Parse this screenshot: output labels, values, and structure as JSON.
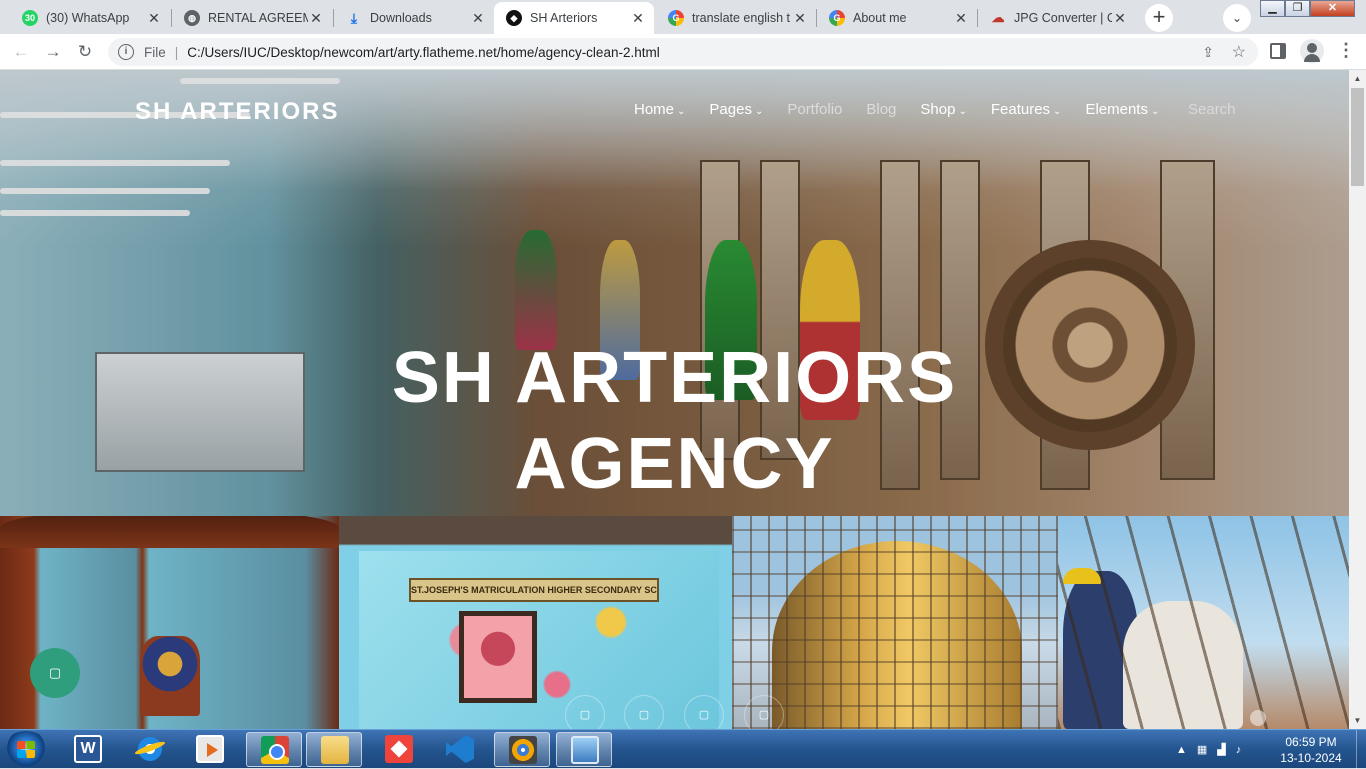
{
  "browser": {
    "tabs": [
      {
        "title": "(30) WhatsApp",
        "favicon": "whatsapp-icon",
        "badge": "30"
      },
      {
        "title": "RENTAL AGREEME",
        "favicon": "globe-icon"
      },
      {
        "title": "Downloads",
        "favicon": "download-icon"
      },
      {
        "title": "SH Arteriors",
        "favicon": "site-logo-icon"
      },
      {
        "title": "translate english t",
        "favicon": "google-icon"
      },
      {
        "title": "About me",
        "favicon": "google-icon"
      },
      {
        "title": "JPG Converter | Cl",
        "favicon": "cloud-icon"
      }
    ],
    "address": {
      "scheme_label": "File",
      "url": "C:/Users/IUC/Desktop/newcom/art/arty.flatheme.net/home/agency-clean-2.html"
    }
  },
  "site": {
    "brand": "SH ARTERIORS",
    "nav": [
      {
        "label": "Home",
        "dropdown": true
      },
      {
        "label": "Pages",
        "dropdown": true
      },
      {
        "label": "Portfolio",
        "dropdown": false
      },
      {
        "label": "Blog",
        "dropdown": false
      },
      {
        "label": "Shop",
        "dropdown": true
      },
      {
        "label": "Features",
        "dropdown": true
      },
      {
        "label": "Elements",
        "dropdown": true
      }
    ],
    "search_label": "Search",
    "hero": {
      "line1": "SH ARTERIORS",
      "line2": "AGENCY"
    },
    "gallery": {
      "school_sign": "ST.JOSEPH'S MATRICULATION HIGHER SECONDARY SCHOOL"
    },
    "fab_glyph": "▢",
    "dot_glyph": "▢"
  },
  "taskbar": {
    "apps": [
      "word",
      "internet-explorer",
      "media-player",
      "chrome",
      "file-explorer",
      "anydesk",
      "vscode",
      "disc-burner",
      "remote-desktop"
    ],
    "word_letter": "W",
    "time": "06:59 PM",
    "date": "13-10-2024"
  }
}
